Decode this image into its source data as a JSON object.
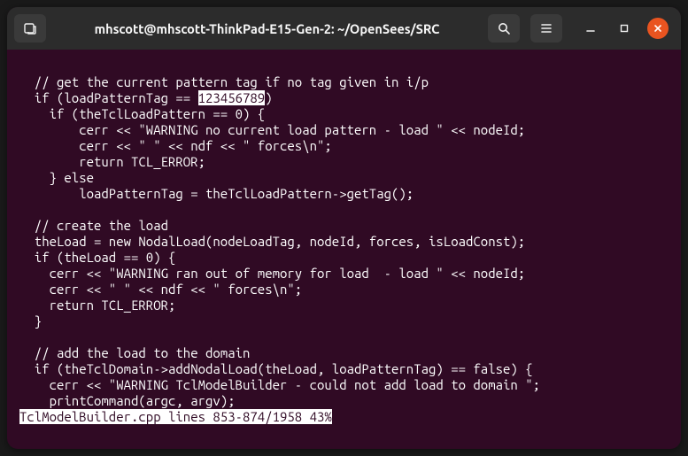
{
  "titlebar": {
    "title": "mhscott@mhscott-ThinkPad-E15-Gen-2: ~/OpenSees/SRC"
  },
  "code": {
    "l0": "",
    "l1": "  // get the current pattern tag if no tag given in i/p",
    "l2a": "  if (loadPatternTag == ",
    "l2hl": "123456789",
    "l2b": ")",
    "l3": "    if (theTclLoadPattern == 0) {",
    "l4": "        cerr << \"WARNING no current load pattern - load \" << nodeId;",
    "l5": "        cerr << \" \" << ndf << \" forces\\n\";",
    "l6": "        return TCL_ERROR;",
    "l7": "    } else",
    "l8": "        loadPatternTag = theTclLoadPattern->getTag();",
    "l9": "",
    "l10": "  // create the load",
    "l11": "  theLoad = new NodalLoad(nodeLoadTag, nodeId, forces, isLoadConst);",
    "l12": "  if (theLoad == 0) {",
    "l13": "    cerr << \"WARNING ran out of memory for load  - load \" << nodeId;",
    "l14": "    cerr << \" \" << ndf << \" forces\\n\";",
    "l15": "    return TCL_ERROR;",
    "l16": "  }",
    "l17": "",
    "l18": "  // add the load to the domain",
    "l19": "  if (theTclDomain->addNodalLoad(theLoad, loadPatternTag) == false) {",
    "l20": "    cerr << \"WARNING TclModelBuilder - could not add load to domain \";",
    "l21": "    printCommand(argc, argv);",
    "status": "TclModelBuilder.cpp lines 853-874/1958 43%"
  }
}
